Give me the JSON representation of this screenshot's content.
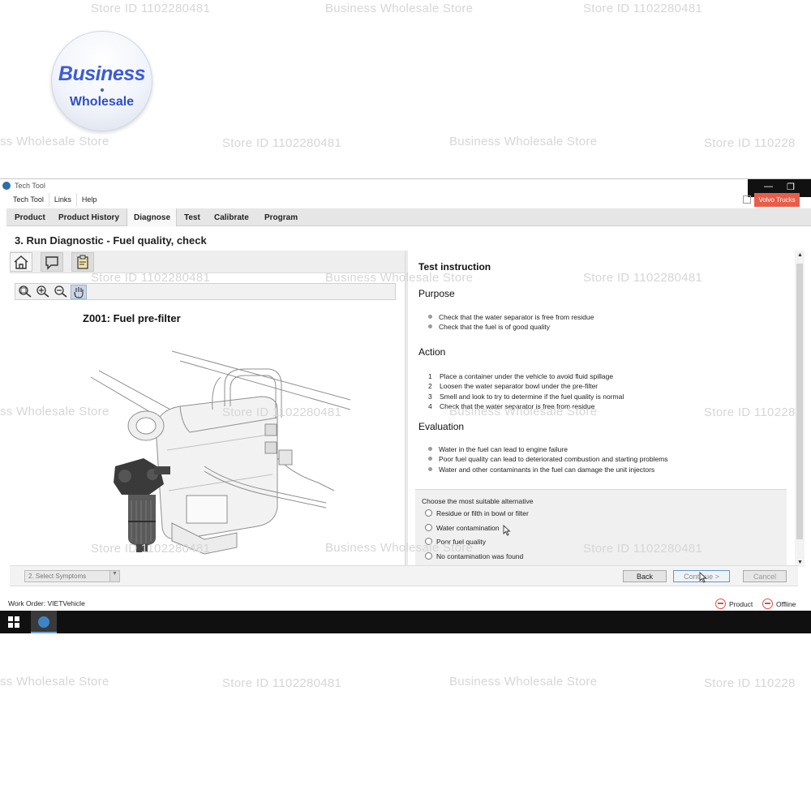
{
  "watermarks": {
    "store_id": "Store ID 1102280481",
    "store_name": "Business Wholesale Store",
    "store_name_cut": "ss Wholesale Store",
    "store_id_cut": "Store ID 110228"
  },
  "logo": {
    "line1": "Business",
    "line2": "Wholesale"
  },
  "window": {
    "title": "Tech Tool",
    "volvo_button": "Volvo Trucks"
  },
  "menu": [
    "Tech Tool",
    "Links",
    "Help"
  ],
  "tabs": [
    "Product",
    "Product History",
    "Diagnose",
    "Test",
    "Calibrate",
    "Program"
  ],
  "active_tab": "Diagnose",
  "page_title": "3. Run Diagnostic - Fuel quality, check",
  "figure_title": "Z001: Fuel pre-filter",
  "instruction": {
    "heading": "Test instruction",
    "purpose_heading": "Purpose",
    "purpose": [
      "Check that the water separator is free from residue",
      "Check that the fuel is of good quality"
    ],
    "action_heading": "Action",
    "action": [
      {
        "n": "1",
        "text": "Place a container under the vehicle to avoid fluid spillage"
      },
      {
        "n": "2",
        "text": "Loosen the water separator bowl under the pre-filter"
      },
      {
        "n": "3",
        "text": "Smell and look to try to determine if the fuel quality is normal"
      },
      {
        "n": "4",
        "text": "Check that the water separator is free from residue"
      }
    ],
    "evaluation_heading": "Evaluation",
    "evaluation": [
      "Water in the fuel can lead to engine failure",
      "Poor fuel quality can lead to deteriorated combustion and starting problems",
      "Water and other contaminants in the fuel can damage the unit injectors"
    ]
  },
  "choice": {
    "question": "Choose the most suitable alternative",
    "options": [
      "Residue or filth in bowl or filter",
      "Water contamination",
      "Poor fuel quality",
      "No contamination was found"
    ]
  },
  "bottom": {
    "select_value": "2. Select Symptoms",
    "back": "Back",
    "continue": "Continue >",
    "cancel": "Cancel"
  },
  "status": {
    "work_order": "Work Order: VIETVehicle",
    "product": "Product",
    "offline": "Offline"
  }
}
